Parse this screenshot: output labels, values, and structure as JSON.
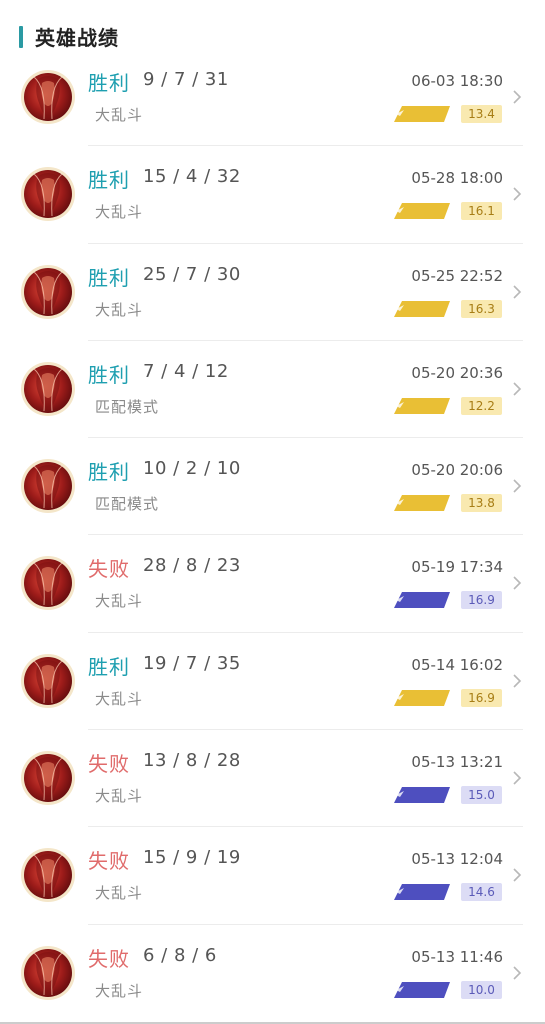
{
  "header": {
    "title": "英雄战绩"
  },
  "colors": {
    "accent": "#2a9aa3",
    "win": "#1e9fb0",
    "loss": "#e06b6b",
    "mvp_gold": "#e9bf35",
    "svp_blue": "#4e4fbf"
  },
  "matches": [
    {
      "result": "胜利",
      "outcome": "win",
      "kda": "9 / 7 / 31",
      "mode": "大乱斗",
      "datetime": "06-03 18:30",
      "badge": "MVP",
      "score": "13.4"
    },
    {
      "result": "胜利",
      "outcome": "win",
      "kda": "15 / 4 / 32",
      "mode": "大乱斗",
      "datetime": "05-28 18:00",
      "badge": "MVP",
      "score": "16.1"
    },
    {
      "result": "胜利",
      "outcome": "win",
      "kda": "25 / 7 / 30",
      "mode": "大乱斗",
      "datetime": "05-25 22:52",
      "badge": "MVP",
      "score": "16.3"
    },
    {
      "result": "胜利",
      "outcome": "win",
      "kda": "7 / 4 / 12",
      "mode": "匹配模式",
      "datetime": "05-20 20:36",
      "badge": "MVP",
      "score": "12.2"
    },
    {
      "result": "胜利",
      "outcome": "win",
      "kda": "10 / 2 / 10",
      "mode": "匹配模式",
      "datetime": "05-20 20:06",
      "badge": "MVP",
      "score": "13.8"
    },
    {
      "result": "失败",
      "outcome": "loss",
      "kda": "28 / 8 / 23",
      "mode": "大乱斗",
      "datetime": "05-19 17:34",
      "badge": "SVP",
      "score": "16.9"
    },
    {
      "result": "胜利",
      "outcome": "win",
      "kda": "19 / 7 / 35",
      "mode": "大乱斗",
      "datetime": "05-14 16:02",
      "badge": "MVP",
      "score": "16.9"
    },
    {
      "result": "失败",
      "outcome": "loss",
      "kda": "13 / 8 / 28",
      "mode": "大乱斗",
      "datetime": "05-13 13:21",
      "badge": "SVP",
      "score": "15.0"
    },
    {
      "result": "失败",
      "outcome": "loss",
      "kda": "15 / 9 / 19",
      "mode": "大乱斗",
      "datetime": "05-13 12:04",
      "badge": "SVP",
      "score": "14.6"
    },
    {
      "result": "失败",
      "outcome": "loss",
      "kda": "6 / 8 / 6",
      "mode": "大乱斗",
      "datetime": "05-13 11:46",
      "badge": "SVP",
      "score": "10.0"
    }
  ]
}
